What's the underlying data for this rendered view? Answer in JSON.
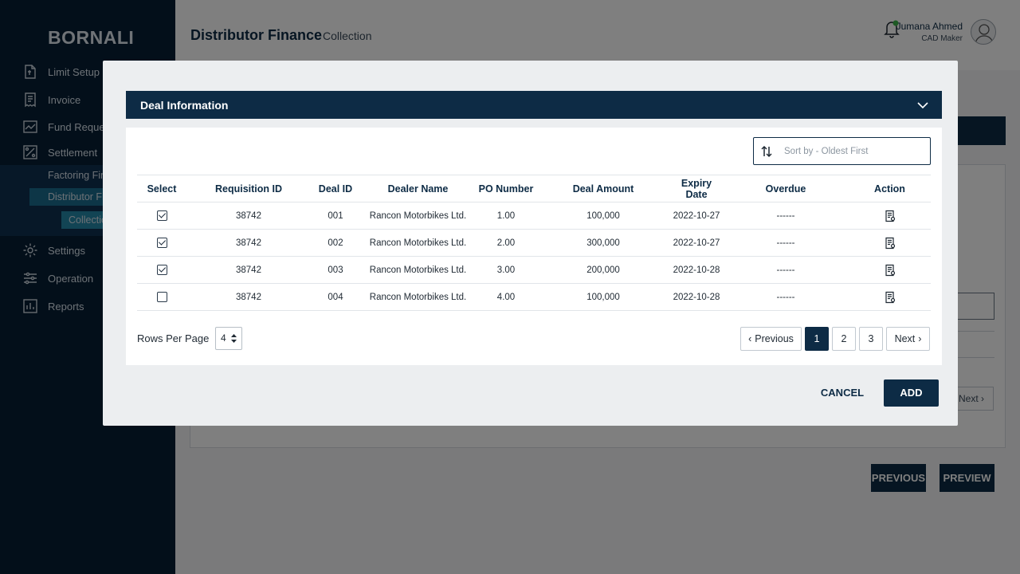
{
  "sidebar": {
    "brand": "BORNALI",
    "items": [
      {
        "label": "Limit Setup",
        "icon": "document-icon"
      },
      {
        "label": "Invoice",
        "icon": "receipt-icon"
      },
      {
        "label": "Fund Reques",
        "icon": "chart-line-icon"
      },
      {
        "label": "Settlement",
        "icon": "percent-icon"
      },
      {
        "label": "Settings",
        "icon": "gear-icon"
      },
      {
        "label": "Operation",
        "icon": "sliders-icon"
      },
      {
        "label": "Reports",
        "icon": "bar-chart-icon"
      }
    ],
    "sub_items": [
      "Factoring Fin",
      "Distributor Fi",
      "Collectio"
    ]
  },
  "header": {
    "title": "Distributor Finance",
    "subtitle": "Collection",
    "user_name": "Jumana Ahmed",
    "user_role": "CAD Maker"
  },
  "background": {
    "next_label": "Next",
    "previous_button": "PREVIOUS",
    "preview_button": "PREVIEW"
  },
  "modal": {
    "section_title": "Deal Information",
    "sort_placeholder": "Sort by - Oldest First",
    "columns": [
      "Select",
      "Requisition ID",
      "Deal ID",
      "Dealer Name",
      "PO Number",
      "Deal Amount",
      "Expiry Date",
      "Overdue",
      "Action"
    ],
    "rows": [
      {
        "checked": true,
        "requisition_id": "38742",
        "deal_id": "001",
        "dealer_name": "Rancon Motorbikes Ltd.",
        "po_number": "1.00",
        "deal_amount": "100,000",
        "expiry_date": "2022-10-27",
        "overdue": "------"
      },
      {
        "checked": true,
        "requisition_id": "38742",
        "deal_id": "002",
        "dealer_name": "Rancon Motorbikes Ltd.",
        "po_number": "2.00",
        "deal_amount": "300,000",
        "expiry_date": "2022-10-27",
        "overdue": "------"
      },
      {
        "checked": true,
        "requisition_id": "38742",
        "deal_id": "003",
        "dealer_name": "Rancon Motorbikes Ltd.",
        "po_number": "3.00",
        "deal_amount": "200,000",
        "expiry_date": "2022-10-28",
        "overdue": "------"
      },
      {
        "checked": false,
        "requisition_id": "38742",
        "deal_id": "004",
        "dealer_name": "Rancon Motorbikes Ltd.",
        "po_number": "4.00",
        "deal_amount": "100,000",
        "expiry_date": "2022-10-28",
        "overdue": "------"
      }
    ],
    "rows_per_page_label": "Rows Per Page",
    "rows_per_page_value": "4",
    "pagination": {
      "previous": "Previous",
      "pages": [
        "1",
        "2",
        "3"
      ],
      "current": "1",
      "next": "Next"
    },
    "cancel_label": "CANCEL",
    "add_label": "ADD"
  },
  "colors": {
    "primary": "#0d2b45",
    "sidebar": "#071f35",
    "accent": "#2488a8",
    "notification_dot": "#3cb44a"
  }
}
